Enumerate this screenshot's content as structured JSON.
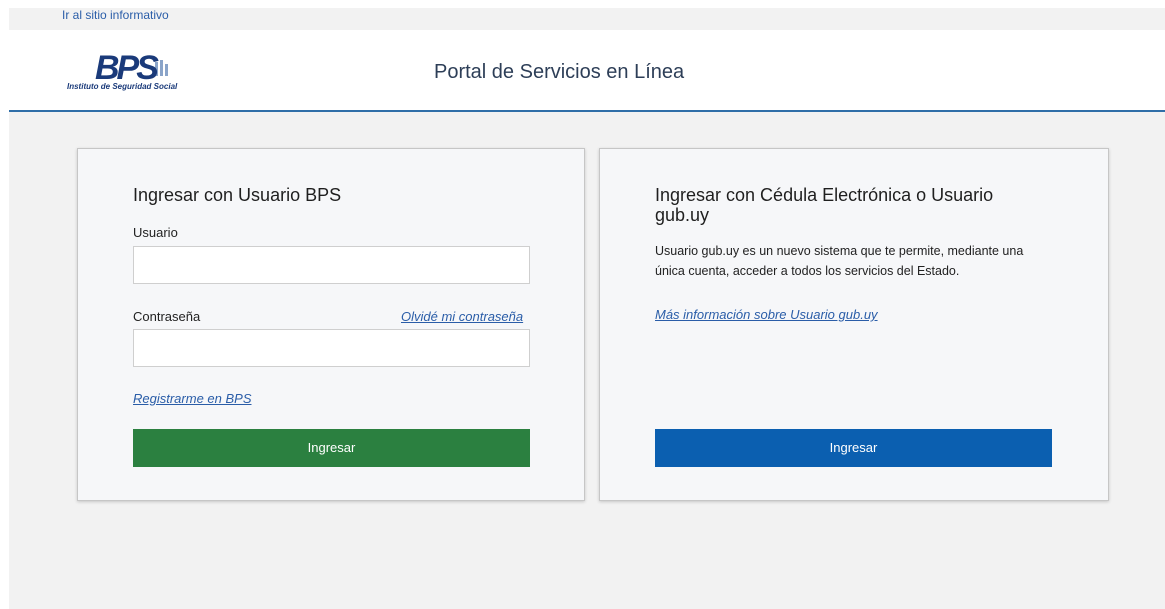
{
  "topbar": {
    "skip_link": "Ir al sitio informativo"
  },
  "header": {
    "logo_text": "BPS",
    "logo_subtitle": "Instituto de Seguridad Social",
    "portal_title": "Portal de Servicios en Línea",
    "accent_color": "#2f6ea8"
  },
  "bps_login": {
    "title": "Ingresar con Usuario BPS",
    "user_label": "Usuario",
    "user_value": "",
    "password_label": "Contraseña",
    "password_value": "",
    "forgot_link": "Olvidé mi contraseña",
    "register_link": "Registrarme en BPS",
    "submit_label": "Ingresar",
    "submit_color": "#2b8040"
  },
  "gubuy_login": {
    "title": "Ingresar con Cédula Electrónica o Usuario gub.uy",
    "description": "Usuario gub.uy es un nuevo sistema que te permite, mediante una única cuenta, acceder a todos los servicios del Estado.",
    "info_link": "Más información sobre Usuario gub.uy",
    "submit_label": "Ingresar",
    "submit_color": "#0b5fb0"
  }
}
